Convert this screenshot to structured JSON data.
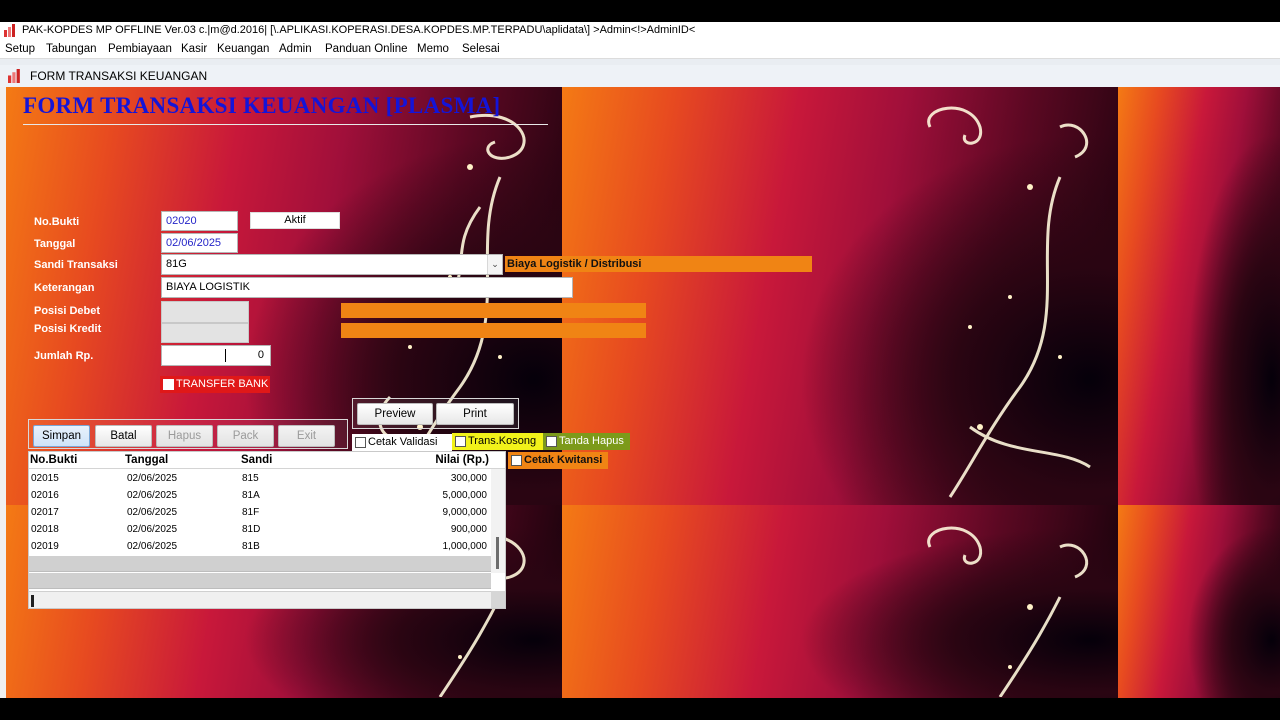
{
  "window": {
    "title": "PAK-KOPDES MP OFFLINE Ver.03 c.|m@d.2016| [\\.APLIKASI.KOPERASI.DESA.KOPDES.MP.TERPADU\\aplidata\\] >Admin<!>AdminID<"
  },
  "menu": [
    "Setup",
    "Tabungan",
    "Pembiayaan",
    "Kasir",
    "Keuangan",
    "Admin",
    "Panduan Online",
    "Memo",
    "Selesai"
  ],
  "child_window": {
    "title": "FORM TRANSAKSI KEUANGAN"
  },
  "form": {
    "heading": "FORM TRANSAKSI KEUANGAN [PLASMA]",
    "labels": {
      "no_bukti": "No.Bukti",
      "tanggal": "Tanggal",
      "sandi": "Sandi Transaksi",
      "keterangan": "Keterangan",
      "posisi_debet": "Posisi Debet",
      "posisi_kredit": "Posisi Kredit",
      "jumlah": "Jumlah Rp."
    },
    "values": {
      "no_bukti": "02020",
      "status": "Aktif",
      "tanggal": "02/06/2025",
      "sandi": "81G",
      "sandi_desc": "Biaya Logistik / Distribusi",
      "keterangan": "BIAYA LOGISTIK",
      "jumlah": "0"
    },
    "transfer_bank": "TRANSFER BANK"
  },
  "buttons": {
    "simpan": "Simpan",
    "batal": "Batal",
    "hapus": "Hapus",
    "pack": "Pack",
    "exit": "Exit",
    "preview": "Preview",
    "print": "Print"
  },
  "checkboxes": {
    "cetak_validasi": "Cetak Validasi",
    "trans_kosong": "Trans.Kosong",
    "tanda_hapus": "Tanda Hapus",
    "cetak_kwitansi": "Cetak Kwitansi"
  },
  "table": {
    "columns": [
      "No.Bukti",
      "Tanggal",
      "Sandi",
      "Nilai (Rp.)"
    ],
    "rows": [
      [
        "02015",
        "02/06/2025",
        "815",
        "300,000"
      ],
      [
        "02016",
        "02/06/2025",
        "81A",
        "5,000,000"
      ],
      [
        "02017",
        "02/06/2025",
        "81F",
        "9,000,000"
      ],
      [
        "02018",
        "02/06/2025",
        "81D",
        "900,000"
      ],
      [
        "02019",
        "02/06/2025",
        "81B",
        "1,000,000"
      ]
    ]
  },
  "colors": {
    "heading": "#1414d8",
    "orange_bar": "#f08414",
    "transfer_bg": "#e01818",
    "trans_kosong_bg": "#f2f21a",
    "tanda_hapus_bg": "#7c9a1a",
    "cetak_kwitansi_bg": "#f08414"
  }
}
